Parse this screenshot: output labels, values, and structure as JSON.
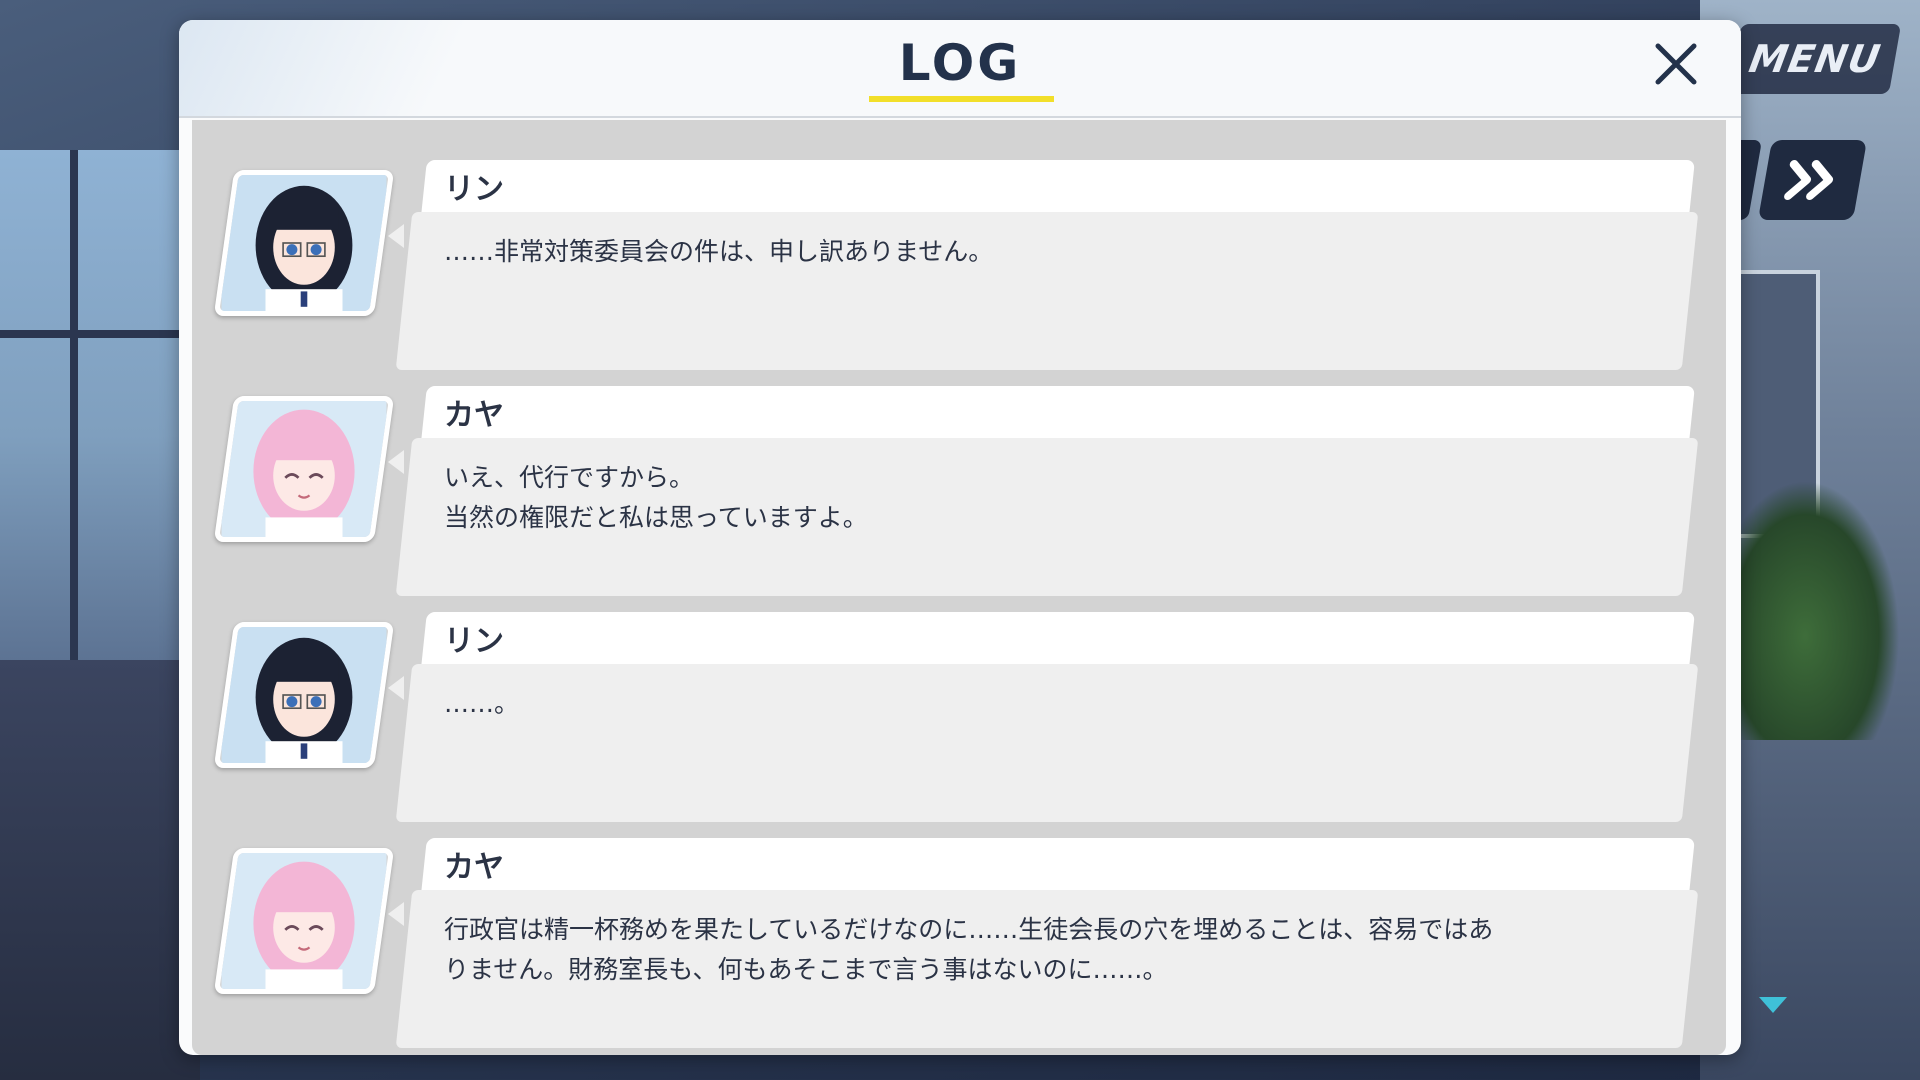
{
  "window": {
    "title": "LOG"
  },
  "controls": {
    "menu_label": "MENU",
    "close_icon": "close-icon",
    "skip_icon": "fast-forward-icon",
    "scroll_icon": "chevron-down-icon"
  },
  "colors": {
    "accent_underline": "#f2df2a",
    "title_text": "#23324b",
    "scroll_arrow": "#3fc1d8"
  },
  "log": {
    "entries": [
      {
        "speaker": "リン",
        "avatar": "rin-portrait",
        "text": "……非常対策委員会の件は、申し訳ありません。"
      },
      {
        "speaker": "カヤ",
        "avatar": "kaya-portrait",
        "text": "いえ、代行ですから。\n当然の権限だと私は思っていますよ。"
      },
      {
        "speaker": "リン",
        "avatar": "rin-portrait",
        "text": "……。"
      },
      {
        "speaker": "カヤ",
        "avatar": "kaya-portrait",
        "text": "行政官は精一杯務めを果たしているだけなのに……生徒会長の穴を埋めることは、容易ではあ\nりません。財務室長も、何もあそこまで言う事はないのに……。"
      }
    ]
  }
}
